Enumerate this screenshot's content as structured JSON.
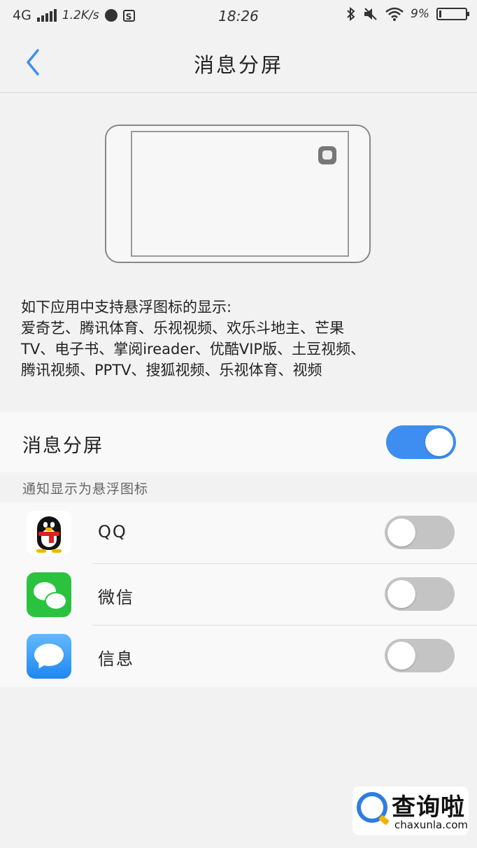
{
  "status_bar": {
    "network": "4G",
    "speed": "1.2K/s",
    "s_badge": "S",
    "time": "18:26",
    "battery": "9%",
    "battery_level": 0.09,
    "icons": [
      "signal-icon",
      "app-dot-icon",
      "s-badge-icon",
      "bluetooth-icon",
      "mute-icon",
      "wifi-icon",
      "battery-icon"
    ]
  },
  "nav": {
    "title": "消息分屏",
    "back_icon": "chevron-left-icon",
    "accent": "#3d8ef0"
  },
  "illustration": {
    "icon": "floating-message-icon"
  },
  "description": {
    "line1": "如下应用中支持悬浮图标的显示:",
    "line2": "爱奇艺、腾讯体育、乐视视频、欢乐斗地主、芒果",
    "line3": "TV、电子书、掌阅ireader、优酷VIP版、土豆视频、",
    "line4": "腾讯视频、PPTV、搜狐视频、乐视体育、视频"
  },
  "main_toggle": {
    "label": "消息分屏",
    "state": "on"
  },
  "section_header": "通知显示为悬浮图标",
  "apps": [
    {
      "name": "QQ",
      "icon": "qq-icon",
      "state": "off"
    },
    {
      "name": "微信",
      "icon": "wechat-icon",
      "state": "off"
    },
    {
      "name": "信息",
      "icon": "messages-icon",
      "state": "off"
    }
  ],
  "watermark": {
    "text": "查询啦",
    "url": "chaxunla.com"
  }
}
